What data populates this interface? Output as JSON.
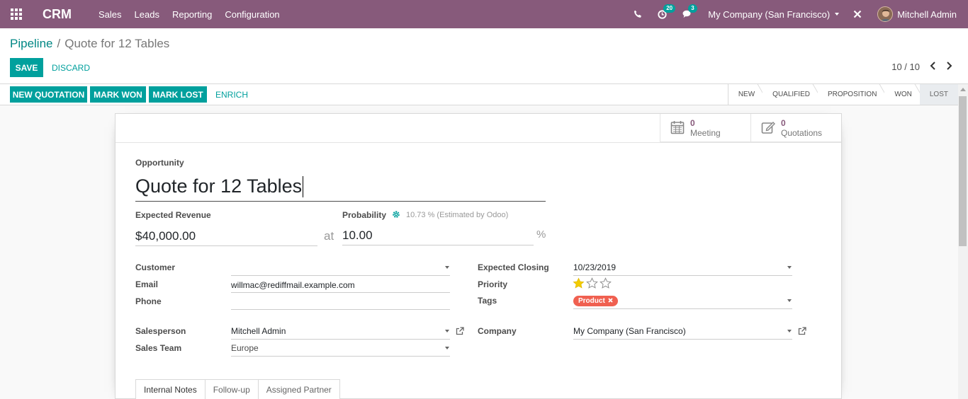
{
  "navbar": {
    "brand": "CRM",
    "menu": [
      "Sales",
      "Leads",
      "Reporting",
      "Configuration"
    ],
    "activity_count": "20",
    "message_count": "3",
    "company": "My Company (San Francisco)",
    "user": "Mitchell Admin"
  },
  "breadcrumb": {
    "parent": "Pipeline",
    "separator": "/",
    "current": "Quote for 12 Tables"
  },
  "actions": {
    "save": "SAVE",
    "discard": "DISCARD"
  },
  "pager": {
    "value": "10 / 10"
  },
  "status_buttons": [
    "NEW QUOTATION",
    "MARK WON",
    "MARK LOST"
  ],
  "enrich": "ENRICH",
  "stages": [
    {
      "label": "NEW",
      "active": false
    },
    {
      "label": "QUALIFIED",
      "active": false
    },
    {
      "label": "PROPOSITION",
      "active": false
    },
    {
      "label": "WON",
      "active": false
    },
    {
      "label": "LOST",
      "active": true
    }
  ],
  "smart_buttons": {
    "meeting": {
      "count": "0",
      "label": "Meeting"
    },
    "quotations": {
      "count": "0",
      "label": "Quotations"
    }
  },
  "form": {
    "opportunity_label": "Opportunity",
    "name": "Quote for 12 Tables",
    "expected_revenue_label": "Expected Revenue",
    "expected_revenue": "$40,000.00",
    "at_label": "at",
    "probability_label": "Probability",
    "probability_hint": "10.73 % (Estimated by Odoo)",
    "probability": "10.00",
    "percent_sign": "%",
    "customer_label": "Customer",
    "customer": "",
    "email_label": "Email",
    "email": "willmac@rediffmail.example.com",
    "phone_label": "Phone",
    "phone": "",
    "salesperson_label": "Salesperson",
    "salesperson": "Mitchell Admin",
    "sales_team_label": "Sales Team",
    "sales_team": "Europe",
    "expected_closing_label": "Expected Closing",
    "expected_closing": "10/23/2019",
    "priority_label": "Priority",
    "priority_stars": 1,
    "priority_max": 3,
    "tags_label": "Tags",
    "tag": "Product",
    "company_label": "Company",
    "company": "My Company (San Francisco)"
  },
  "tabs": [
    "Internal Notes",
    "Follow-up",
    "Assigned Partner"
  ],
  "colors": {
    "brand": "#875a7b",
    "primary": "#00a09d",
    "tag": "#f06050"
  }
}
